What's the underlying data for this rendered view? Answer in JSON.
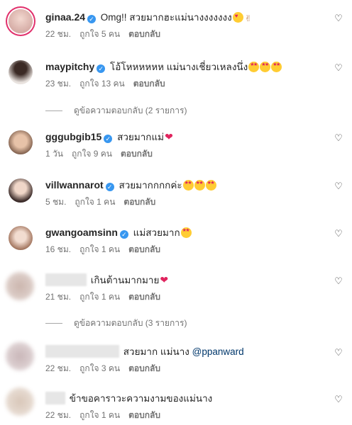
{
  "comments": [
    {
      "user": "ginaa.24",
      "text": "Omg!! สวยมากฮะแม่นางงงงงงง",
      "time": "22 ชม.",
      "likes": "ถูกใจ 5 คน",
      "reply": "ตอบกลับ"
    },
    {
      "user": "maypitchy",
      "text": "โอ้โหหหหหห แม่นางเชี่ยวเหลงนึ่ง",
      "time": "23 ชม.",
      "likes": "ถูกใจ 13 คน",
      "reply": "ตอบกลับ"
    },
    {
      "user": "gggubgib15",
      "text": "สวยมากแม่",
      "time": "1 วัน",
      "likes": "ถูกใจ 9 คน",
      "reply": "ตอบกลับ"
    },
    {
      "user": "villwannarot",
      "text": "สวยมากกกกค่ะ",
      "time": "5 ชม.",
      "likes": "ถูกใจ 1 คน",
      "reply": "ตอบกลับ"
    },
    {
      "user": "gwangoamsinn",
      "text": "แม่สวยมาก",
      "time": "16 ชม.",
      "likes": "ถูกใจ 1 คน",
      "reply": "ตอบกลับ"
    },
    {
      "user": "",
      "text": "เกินต้านมากมาย",
      "time": "21 ชม.",
      "likes": "ถูกใจ 1 คน",
      "reply": "ตอบกลับ"
    },
    {
      "user": "",
      "text": "สวยมาก แม่นาง",
      "mention": "@ppanward",
      "time": "22 ชม.",
      "likes": "ถูกใจ 3 คน",
      "reply": "ตอบกลับ"
    },
    {
      "user": "",
      "text": "ข้าขอคาราวะความงามของแม่นาง",
      "time": "22 ชม.",
      "likes": "ถูกใจ 1 คน",
      "reply": "ตอบกลับ"
    }
  ],
  "threads": [
    {
      "label": "ดูข้อความตอบกลับ (2 รายการ)"
    },
    {
      "label": "ดูข้อความตอบกลับ (3 รายการ)"
    }
  ],
  "icons": {
    "like": "heart-outline-icon",
    "verified": "verified-badge-icon"
  },
  "colors": {
    "verified": "#3897f0",
    "meta": "#737373",
    "mention": "#00376b"
  }
}
